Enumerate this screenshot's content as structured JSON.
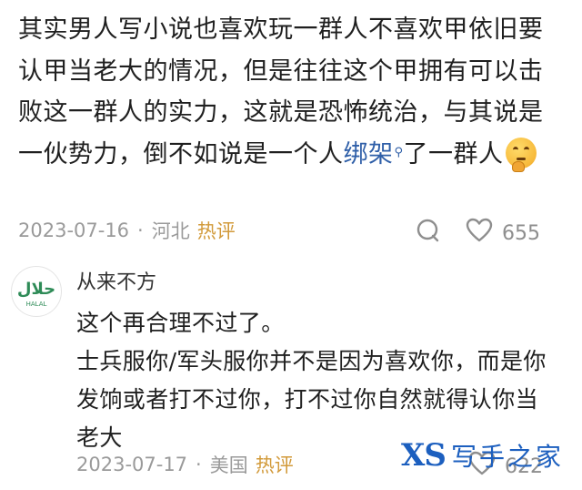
{
  "comment": {
    "text_before": "其实男人写小说也喜欢玩一群人不喜欢甲依旧要认甲当老大的情况，但是往往这个甲拥有可以击败这一群人的实力，这就是恐怖统治，与其说是一伙势力，倒不如说是一个人",
    "keyword": "绑架",
    "text_after": "了一群人",
    "emoji": "thinking-face-emoji",
    "date": "2023-07-16",
    "location": "河北",
    "tag": "热评",
    "like_count": "655",
    "separator": "·"
  },
  "reply": {
    "username": "从来不方",
    "avatar_text": "حلال",
    "avatar_sub": "HALAL",
    "lines": [
      "这个再合理不过了。",
      "士兵服你/军头服你并不是因为喜欢你，而是你发饷或者打不过你，打不过你自然就得认你当老大"
    ],
    "date": "2023-07-17",
    "location": "美国",
    "tag": "热评",
    "like_count": "622"
  },
  "watermark": {
    "logo": "XS",
    "name": "写手之家"
  },
  "colors": {
    "link": "#2f5fa8",
    "hot": "#d29a3a",
    "meta": "#9a9a9a",
    "avatar_green": "#2e8b57",
    "watermark": "#1c5fbf"
  }
}
